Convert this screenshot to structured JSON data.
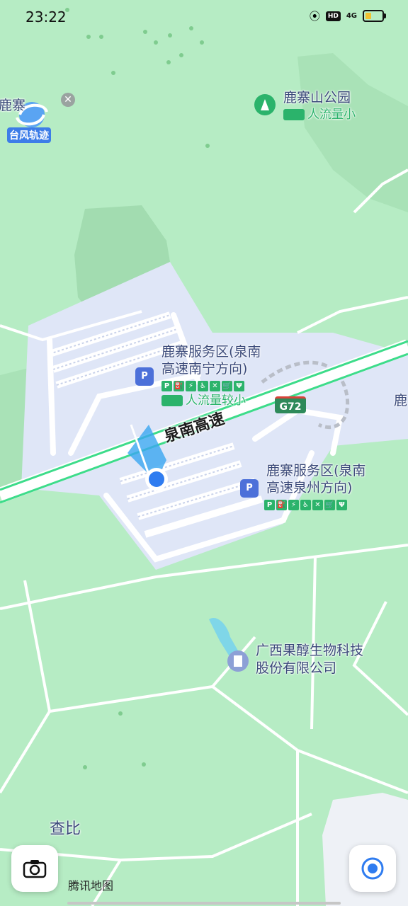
{
  "status": {
    "time": "23:22",
    "network": "4G"
  },
  "map": {
    "labels": {
      "park": "鹿寨山公园",
      "park_crowd": "人流量小",
      "service_north_1": "鹿寨服务区(泉南",
      "service_north_2": "高速南宁方向)",
      "service_north_crowd": "人流量较小",
      "service_south_1": "鹿寨服务区(泉南",
      "service_south_2": "高速泉州方向)",
      "highway": "泉南高速",
      "highway_shield": "G72",
      "company_1": "广西果醇生物科技",
      "company_2": "股份有限公司",
      "village": "查比",
      "town_left": "鹿寨",
      "town_right": "鹿"
    },
    "poi_icon_text": "P",
    "amenity_chips": [
      "P",
      "⛽",
      "⚡",
      "♿",
      "✕",
      "🛒",
      "Ψ"
    ],
    "watermark": "腾讯地图"
  },
  "typhoon": {
    "label": "台风轨迹"
  },
  "colors": {
    "land": "#b6ecc4",
    "service_area": "#dfe6f7",
    "highway": "#3ddc8a",
    "road": "#ffffff",
    "water": "#7fd6e8",
    "location": "#2f7cf0"
  }
}
